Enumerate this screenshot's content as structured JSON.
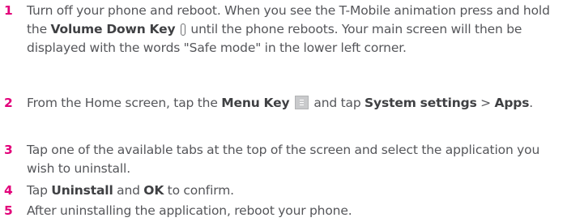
{
  "steps": [
    {
      "number": "1",
      "text_1": "Turn off your phone and reboot. When you see the T-Mobile animation press and hold the ",
      "bold_1": "Volume Down Key",
      "text_2": " until the phone reboots. Your main screen will then be displayed with the words \"Safe mode\" in the lower left corner."
    },
    {
      "number": "2",
      "text_1": "From the Home screen, tap the ",
      "bold_1": "Menu Key",
      "text_2": " and tap ",
      "bold_2": "System settings",
      "text_3": " > ",
      "bold_3": "Apps",
      "text_4": "."
    },
    {
      "number": "3",
      "text_1": "Tap one of the available tabs at the top of the screen and select the application you wish to uninstall."
    },
    {
      "number": "4",
      "text_1": "Tap ",
      "bold_1": "Uninstall",
      "text_2": " and ",
      "bold_2": "OK",
      "text_3": " to confirm."
    },
    {
      "number": "5",
      "text_1": "After uninstalling the application, reboot your phone."
    }
  ],
  "icons": {
    "step1": "volume-down-key-icon",
    "step2": "menu-key-icon"
  },
  "colors": {
    "step_number": "#e2007a",
    "body_text": "#55565a"
  }
}
